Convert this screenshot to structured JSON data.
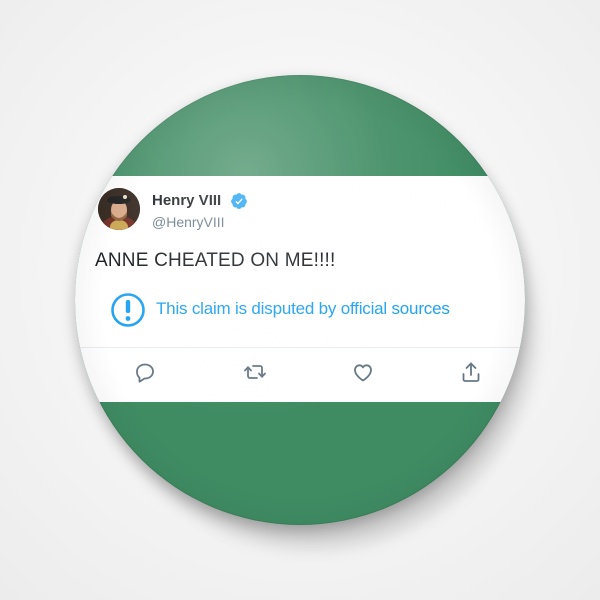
{
  "tweet": {
    "display_name": "Henry VIII",
    "handle": "@HenryVIII",
    "text": "ANNE CHEATED ON ME!!!!",
    "dispute_notice": "This claim is disputed by official sources",
    "verified": true
  },
  "icons": {
    "avatar": "portrait-avatar",
    "verified": "verified-badge-icon",
    "dispute": "exclamation-circle-icon",
    "actions": [
      "reply-icon",
      "retweet-icon",
      "like-icon",
      "share-icon"
    ]
  },
  "colors": {
    "pin_background": "#3f8c63",
    "card_background": "#ffffff",
    "accent": "#1da1f2",
    "text_primary": "#14171a",
    "text_secondary": "#657786",
    "icon_gray": "#657786"
  }
}
